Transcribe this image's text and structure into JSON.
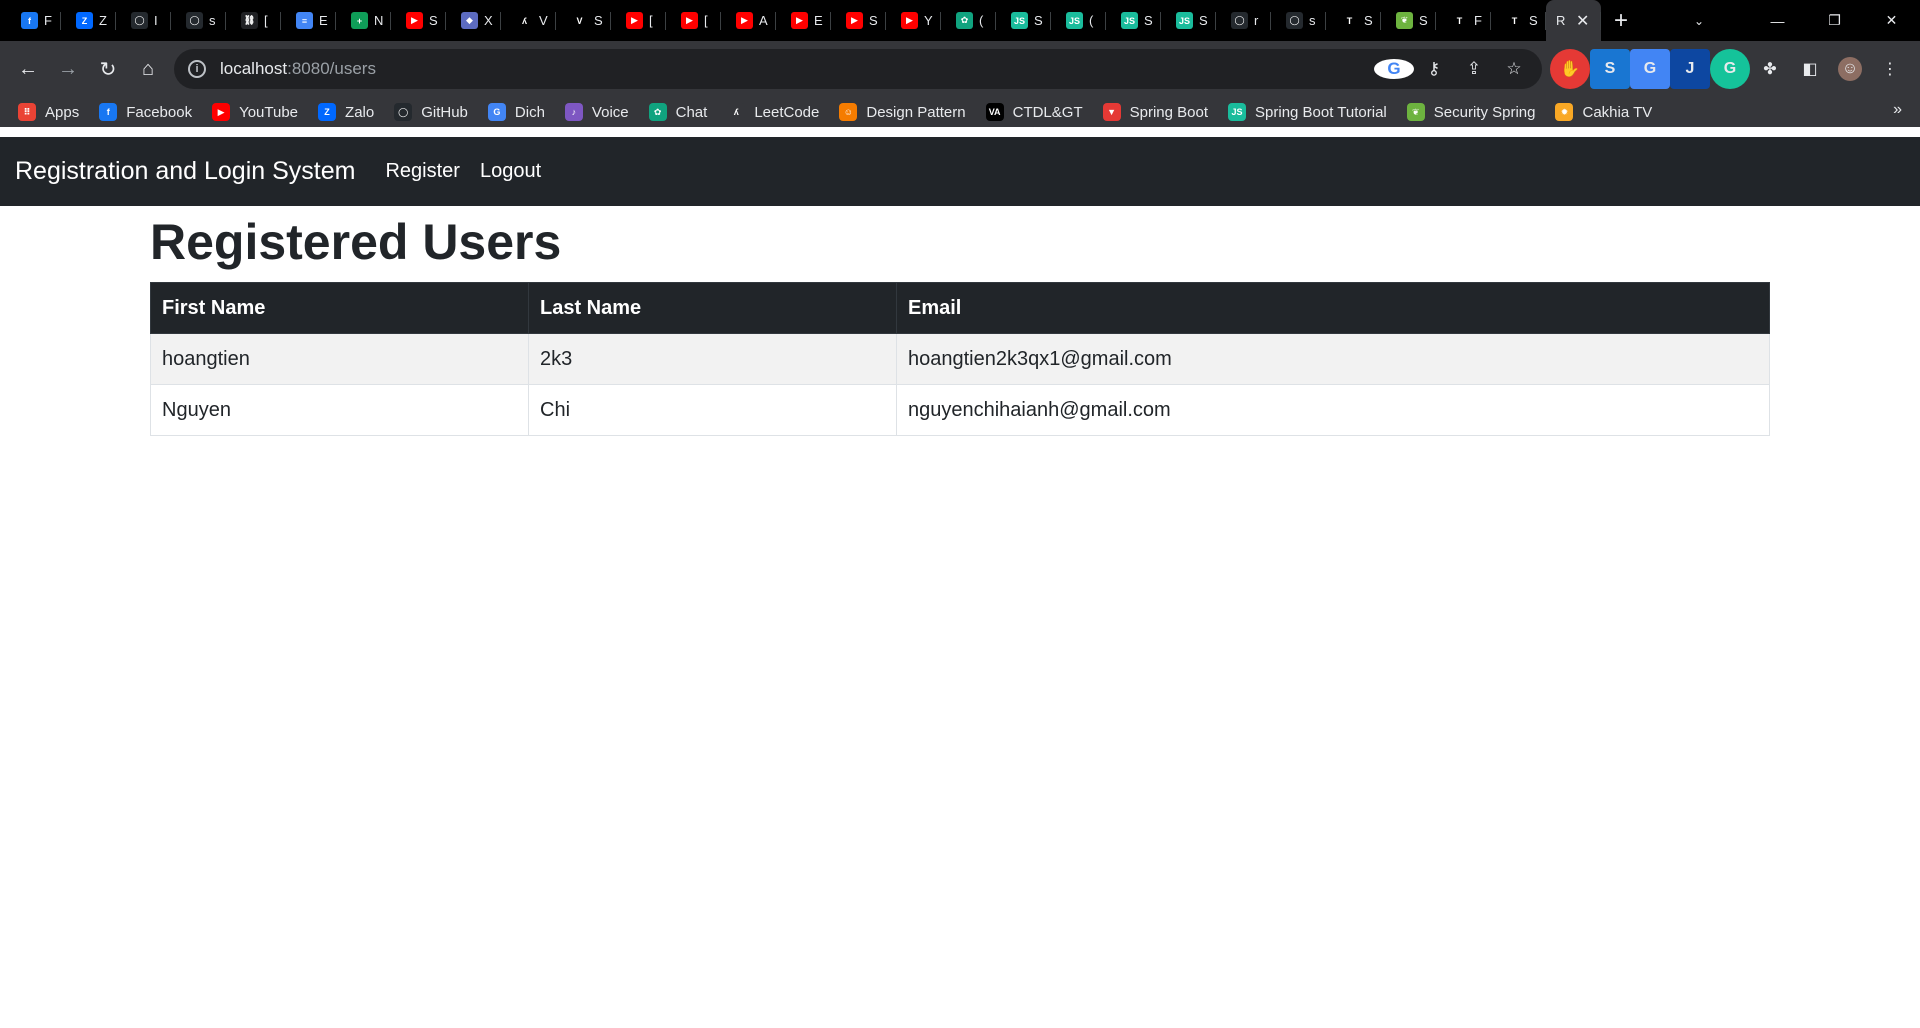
{
  "browser": {
    "tabs": [
      {
        "icon": "facebook-icon",
        "color": "#1877f2",
        "glyph": "f",
        "title": "F"
      },
      {
        "icon": "zalo-icon",
        "color": "#0068ff",
        "glyph": "Z",
        "title": "Z"
      },
      {
        "icon": "github-icon",
        "color": "#24292e",
        "glyph": "◯",
        "title": "I"
      },
      {
        "icon": "github-icon",
        "color": "#24292e",
        "glyph": "◯",
        "title": "s"
      },
      {
        "icon": "link-icon",
        "color": "#202124",
        "glyph": "⛓",
        "title": "["
      },
      {
        "icon": "docs-icon",
        "color": "#4285f4",
        "glyph": "≡",
        "title": "E"
      },
      {
        "icon": "sheets-icon",
        "color": "#0f9d58",
        "glyph": "+",
        "title": "N"
      },
      {
        "icon": "youtube-icon",
        "color": "#ff0000",
        "glyph": "▶",
        "title": "S"
      },
      {
        "icon": "shield-icon",
        "color": "#5c6bc0",
        "glyph": "◆",
        "title": "X"
      },
      {
        "icon": "leetcode-icon",
        "color": "#000000",
        "glyph": "ʎ",
        "title": "V"
      },
      {
        "icon": "v-icon",
        "color": "#000000",
        "glyph": "V",
        "title": "S"
      },
      {
        "icon": "youtube-icon",
        "color": "#ff0000",
        "glyph": "▶",
        "title": "["
      },
      {
        "icon": "youtube-icon",
        "color": "#ff0000",
        "glyph": "▶",
        "title": "["
      },
      {
        "icon": "youtube-icon",
        "color": "#ff0000",
        "glyph": "▶",
        "title": "A"
      },
      {
        "icon": "youtube-icon",
        "color": "#ff0000",
        "glyph": "▶",
        "title": "E"
      },
      {
        "icon": "youtube-icon",
        "color": "#ff0000",
        "glyph": "▶",
        "title": "S"
      },
      {
        "icon": "youtube-icon",
        "color": "#ff0000",
        "glyph": "▶",
        "title": "Y"
      },
      {
        "icon": "chatgpt-icon",
        "color": "#10a37f",
        "glyph": "✿",
        "title": "("
      },
      {
        "icon": "js-icon",
        "color": "#1abc9c",
        "glyph": "JS",
        "title": "S"
      },
      {
        "icon": "js-icon",
        "color": "#1abc9c",
        "glyph": "JS",
        "title": "("
      },
      {
        "icon": "js-icon",
        "color": "#1abc9c",
        "glyph": "JS",
        "title": "S"
      },
      {
        "icon": "js-icon",
        "color": "#1abc9c",
        "glyph": "JS",
        "title": "S"
      },
      {
        "icon": "github-icon",
        "color": "#24292e",
        "glyph": "◯",
        "title": "r"
      },
      {
        "icon": "github-icon",
        "color": "#24292e",
        "glyph": "◯",
        "title": "s"
      },
      {
        "icon": "t-icon",
        "color": "#000000",
        "glyph": "T",
        "title": "S"
      },
      {
        "icon": "spring-icon",
        "color": "#6db33f",
        "glyph": "❦",
        "title": "S"
      },
      {
        "icon": "t-icon",
        "color": "#000000",
        "glyph": "T",
        "title": "F"
      },
      {
        "icon": "t-icon",
        "color": "#000000",
        "glyph": "T",
        "title": "S"
      }
    ],
    "active_tab": {
      "title": "R",
      "close": "✕"
    },
    "new_tab": "+",
    "url_host": "localhost",
    "url_path": ":8080/users"
  },
  "bookmarks": [
    {
      "label": "Apps",
      "icon": "apps-grid-icon",
      "color": "#ea4335",
      "glyph": "⠿"
    },
    {
      "label": "Facebook",
      "icon": "facebook-icon",
      "color": "#1877f2",
      "glyph": "f"
    },
    {
      "label": "YouTube",
      "icon": "youtube-icon",
      "color": "#ff0000",
      "glyph": "▶"
    },
    {
      "label": "Zalo",
      "icon": "zalo-icon",
      "color": "#0068ff",
      "glyph": "Z"
    },
    {
      "label": "GitHub",
      "icon": "github-icon",
      "color": "#24292e",
      "glyph": "◯"
    },
    {
      "label": "Dich",
      "icon": "translate-icon",
      "color": "#4285f4",
      "glyph": "G"
    },
    {
      "label": "Voice",
      "icon": "voice-icon",
      "color": "#7e57c2",
      "glyph": "♪"
    },
    {
      "label": "Chat",
      "icon": "chatgpt-icon",
      "color": "#10a37f",
      "glyph": "✿"
    },
    {
      "label": "LeetCode",
      "icon": "leetcode-icon",
      "color": "#35363a",
      "glyph": "ʎ"
    },
    {
      "label": "Design Pattern",
      "icon": "design-pattern-icon",
      "color": "#f57c00",
      "glyph": "☺"
    },
    {
      "label": "CTDL&GT",
      "icon": "va-icon",
      "color": "#000000",
      "glyph": "VA"
    },
    {
      "label": "Spring Boot",
      "icon": "spring-boot-icon",
      "color": "#e53935",
      "glyph": "▼"
    },
    {
      "label": "Spring Boot Tutorial",
      "icon": "js-icon",
      "color": "#1abc9c",
      "glyph": "JS"
    },
    {
      "label": "Security Spring",
      "icon": "spring-icon",
      "color": "#6db33f",
      "glyph": "❦"
    },
    {
      "label": "Cakhia TV",
      "icon": "cakhia-icon",
      "color": "#f9a825",
      "glyph": "✹"
    }
  ],
  "app": {
    "brand": "Registration and Login System",
    "nav": {
      "register": "Register",
      "logout": "Logout"
    },
    "page_title": "Registered Users",
    "table": {
      "headers": [
        "First Name",
        "Last Name",
        "Email"
      ],
      "rows": [
        [
          "hoangtien",
          "2k3",
          "hoangtien2k3qx1@gmail.com"
        ],
        [
          "Nguyen",
          "Chi",
          "nguyenchihaianh@gmail.com"
        ]
      ]
    }
  }
}
